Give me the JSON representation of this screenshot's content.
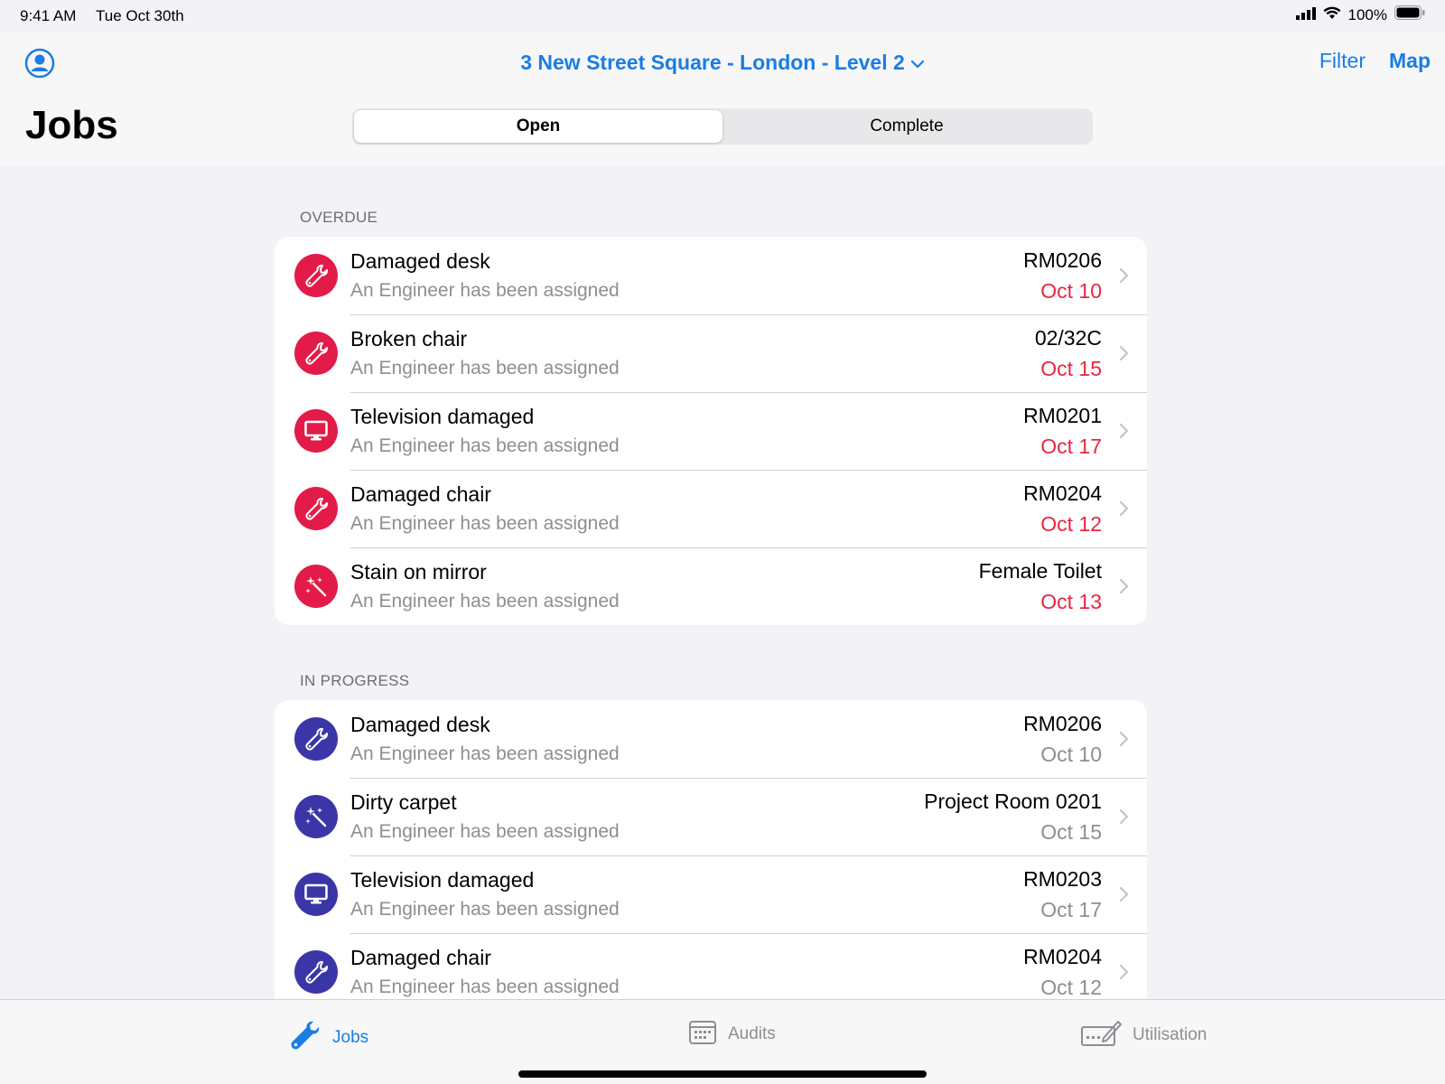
{
  "status_bar": {
    "time": "9:41 AM",
    "date": "Tue Oct 30th",
    "battery": "100%"
  },
  "nav": {
    "location_title": "3 New Street Square - London - Level 2",
    "filter_label": "Filter",
    "map_label": "Map",
    "page_title": "Jobs"
  },
  "segments": {
    "open": "Open",
    "complete": "Complete",
    "selected": "Open"
  },
  "colors": {
    "accent": "#1a7de2",
    "overdue": "#e21b48",
    "in_progress": "#3b36a8",
    "overdue_date": "#e8263f"
  },
  "sections": {
    "overdue": {
      "header": "OVERDUE",
      "rows": [
        {
          "icon": "wrench-icon",
          "title": "Damaged desk",
          "subtitle": "An Engineer has been assigned",
          "location": "RM0206",
          "date": "Oct 10"
        },
        {
          "icon": "wrench-icon",
          "title": "Broken chair",
          "subtitle": "An Engineer has been assigned",
          "location": "02/32C",
          "date": "Oct 15"
        },
        {
          "icon": "monitor-icon",
          "title": "Television damaged",
          "subtitle": "An Engineer has been assigned",
          "location": "RM0201",
          "date": "Oct 17"
        },
        {
          "icon": "wrench-icon",
          "title": "Damaged chair",
          "subtitle": "An Engineer has been assigned",
          "location": "RM0204",
          "date": "Oct 12"
        },
        {
          "icon": "sparkle-wand-icon",
          "title": "Stain on mirror",
          "subtitle": "An Engineer has been assigned",
          "location": "Female Toilet",
          "date": "Oct 13"
        }
      ]
    },
    "in_progress": {
      "header": "IN PROGRESS",
      "rows": [
        {
          "icon": "wrench-icon",
          "title": "Damaged desk",
          "subtitle": "An Engineer has been assigned",
          "location": "RM0206",
          "date": "Oct 10"
        },
        {
          "icon": "sparkle-wand-icon",
          "title": "Dirty carpet",
          "subtitle": "An Engineer has been assigned",
          "location": "Project Room 0201",
          "date": "Oct 15"
        },
        {
          "icon": "monitor-icon",
          "title": "Television damaged",
          "subtitle": "An Engineer has been assigned",
          "location": "RM0203",
          "date": "Oct 17"
        },
        {
          "icon": "wrench-icon",
          "title": "Damaged chair",
          "subtitle": "An Engineer has been assigned",
          "location": "RM0204",
          "date": "Oct 12"
        }
      ]
    }
  },
  "tabs": {
    "jobs": {
      "label": "Jobs",
      "icon": "wrench-icon"
    },
    "audits": {
      "label": "Audits",
      "icon": "calendar-icon"
    },
    "utilisation": {
      "label": "Utilisation",
      "icon": "clipboard-pen-icon"
    },
    "selected": "Jobs"
  }
}
